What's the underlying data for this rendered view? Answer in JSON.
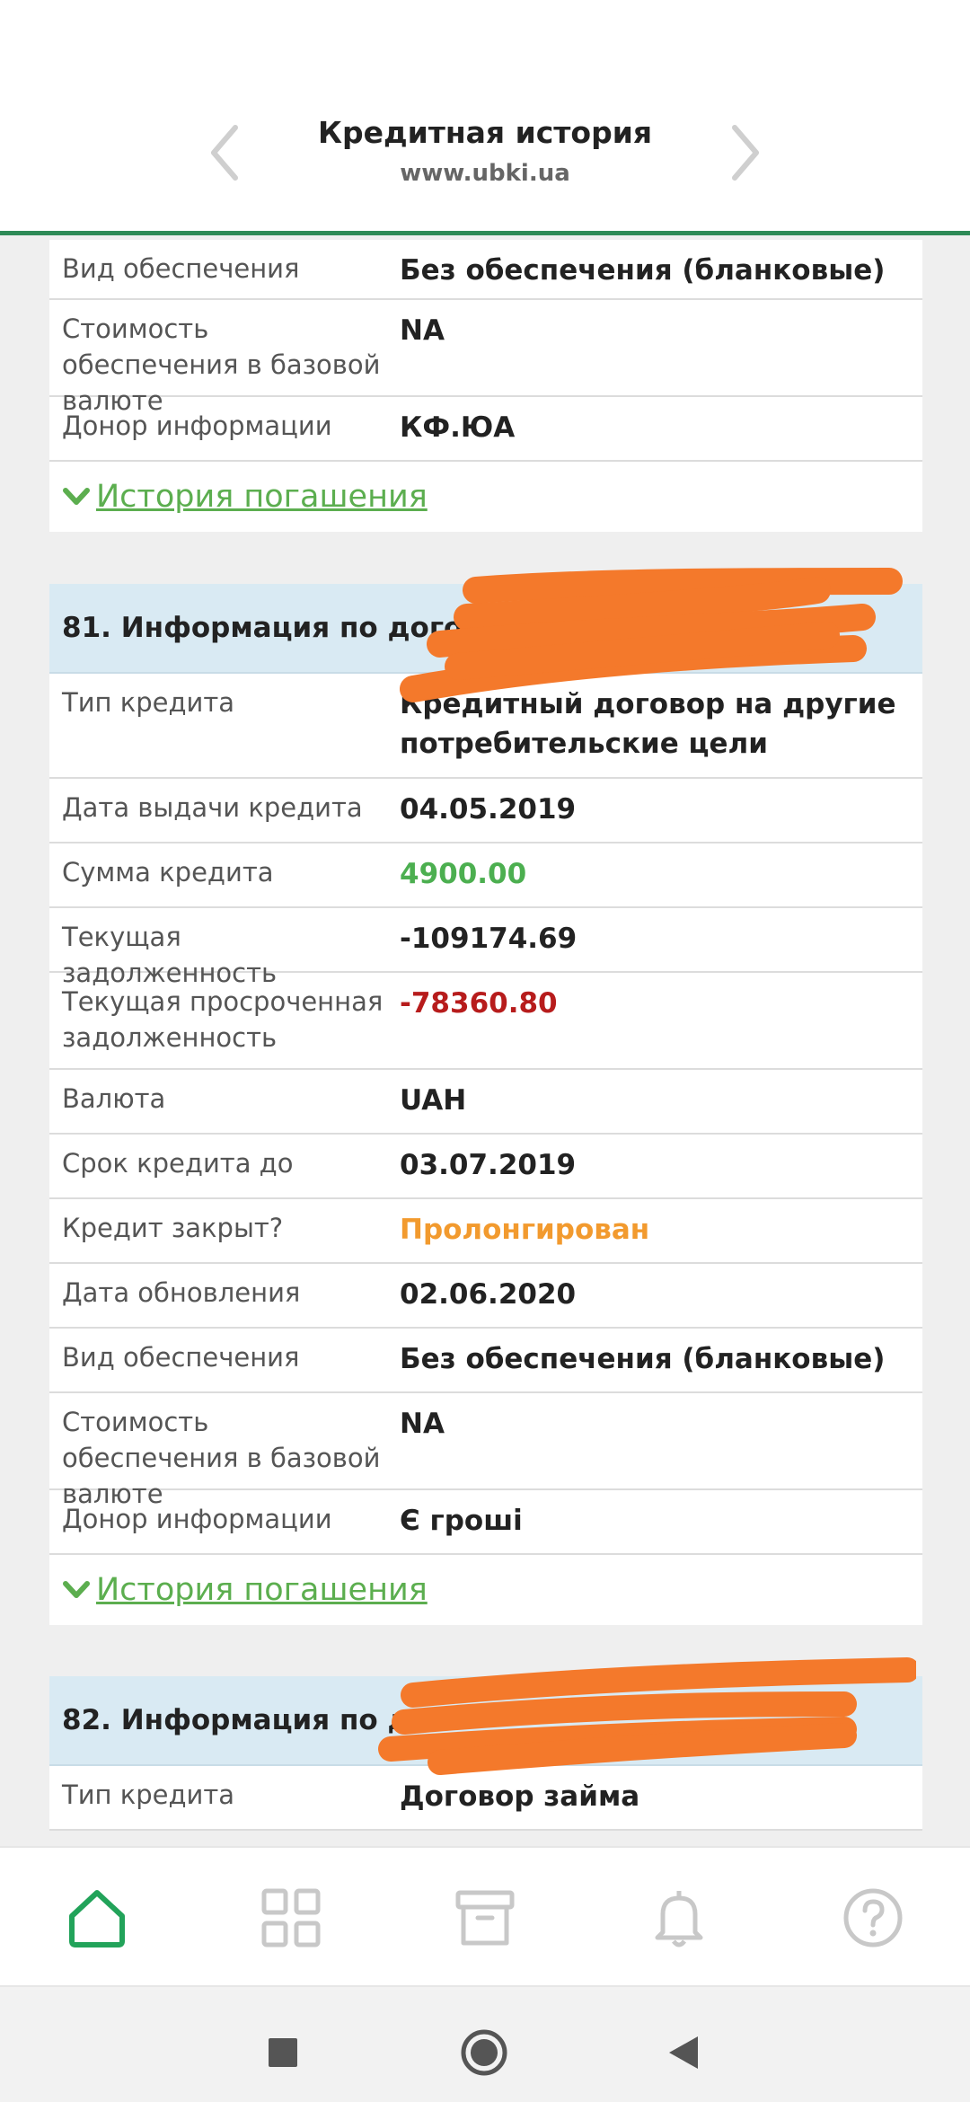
{
  "header": {
    "title": "Кредитная история",
    "subtitle": "www.ubki.ua"
  },
  "card_prev": {
    "rows": [
      {
        "label": "Вид обеспечения",
        "value": "Без обеспечения (бланковые)"
      },
      {
        "label": "Стоимость обеспечения в базовой валюте",
        "value": "NA"
      },
      {
        "label": "Донор информации",
        "value": "КФ.ЮА"
      }
    ],
    "history_link": "История погашения"
  },
  "card_81": {
    "heading": "81. Информация по договору (",
    "rows": [
      {
        "label": "Тип кредита",
        "value": "Кредитный договор на другие потребительские цели"
      },
      {
        "label": "Дата выдачи кредита",
        "value": "04.05.2019"
      },
      {
        "label": "Сумма кредита",
        "value": "4900.00"
      },
      {
        "label": "Текущая задолженность",
        "value": "-109174.69"
      },
      {
        "label": "Текущая просроченная задолженность",
        "value": "-78360.80"
      },
      {
        "label": "Валюта",
        "value": "UAH"
      },
      {
        "label": "Срок кредита до",
        "value": "03.07.2019"
      },
      {
        "label": "Кредит закрыт?",
        "value": "Пролонгирован"
      },
      {
        "label": "Дата обновления",
        "value": "02.06.2020"
      },
      {
        "label": "Вид обеспечения",
        "value": "Без обеспечения (бланковые)"
      },
      {
        "label": "Стоимость обеспечения в базовой валюте",
        "value": "NA"
      },
      {
        "label": "Донор информации",
        "value": "Є гроші"
      }
    ],
    "history_link": "История погашения"
  },
  "card_82": {
    "heading": "82. Информация по дог",
    "rows": [
      {
        "label": "Тип кредита",
        "value": "Договор займа"
      }
    ]
  },
  "colors": {
    "accent_green": "#2e8b57",
    "amount_green": "#4caf50",
    "overdue_red": "#b71c1c",
    "status_orange": "#f29a2e",
    "redaction_orange": "#f4792b",
    "section_blue": "#d9eaf3"
  },
  "icons": {
    "tabs": [
      "home-icon",
      "grid-icon",
      "archive-icon",
      "bell-icon",
      "help-icon"
    ],
    "system": [
      "recents-square-icon",
      "home-circle-icon",
      "back-triangle-icon"
    ]
  }
}
